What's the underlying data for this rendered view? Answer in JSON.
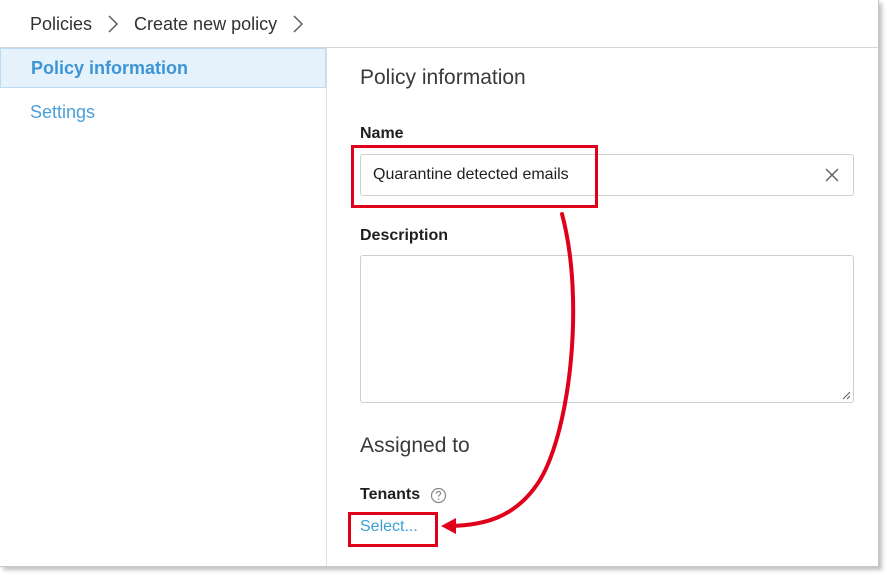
{
  "breadcrumb": {
    "items": [
      "Policies",
      "Create new policy"
    ]
  },
  "nav": {
    "items": [
      {
        "label": "Policy information",
        "active": true
      },
      {
        "label": "Settings",
        "active": false
      }
    ]
  },
  "form": {
    "section_title": "Policy information",
    "name_label": "Name",
    "name_value": "Quarantine detected emails",
    "description_label": "Description",
    "description_value": "",
    "assigned_title": "Assigned to",
    "tenants_label": "Tenants",
    "select_link": "Select..."
  },
  "colors": {
    "accent": "#3c95d5",
    "annotation": "#e0001b",
    "nav_active_bg": "#e5f1fb"
  }
}
